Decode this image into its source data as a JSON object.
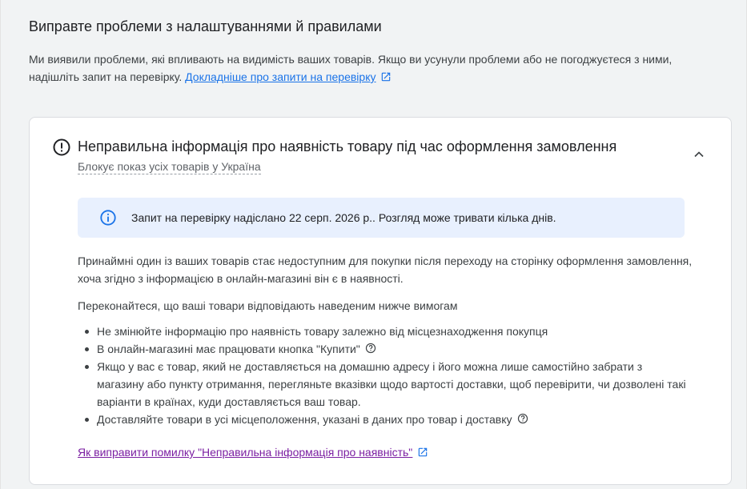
{
  "header": {
    "title": "Виправте проблеми з налаштуваннями й правилами",
    "intro_text": "Ми виявили проблеми, які впливають на видимість ваших товарів. Якщо ви усунули проблеми або не погоджуєтеся з ними, надішліть запит на перевірку.",
    "intro_link": "Докладніше про запити на перевірку"
  },
  "issue": {
    "title": "Неправильна інформація про наявність товару під час оформлення замовлення",
    "subtitle": "Блокує показ усіх товарів у Україна",
    "info_message": "Запит на перевірку надіслано 22 серп. 2026 р.. Розгляд може тривати кілька днів.",
    "description": "Принаймні один із ваших товарів стає недоступним для покупки після переходу на сторінку оформлення замовлення, хоча згідно з інформацією в онлайн-магазині він є в наявності.",
    "requirements_intro": "Переконайтеся, що ваші товари відповідають наведеним нижче вимогам",
    "requirements": [
      "Не змінюйте інформацію про наявність товару залежно від місцезнаходження покупця",
      "В онлайн-магазині має працювати кнопка \"Купити\"",
      "Якщо у вас є товар, який не доставляється на домашню адресу і його можна лише самостійно забрати з магазину або пункту отримання, перегляньте вказівки щодо вартості доставки, щоб перевірити, чи дозволені такі варіанти в країнах, куди доставляється ваш товар.",
      "Доставляйте товари в усі місцеположення, указані в даних про товар і доставку"
    ],
    "fix_link": "Як виправити помилку \"Неправильна інформація про наявність\""
  },
  "colors": {
    "link": "#1a73e8",
    "visited_link": "#7b1fa2",
    "info_bg": "#e8f0fe",
    "info_icon": "#1a73e8"
  },
  "icons": [
    "external-link-icon",
    "error-outline-icon",
    "chevron-up-icon",
    "info-icon",
    "help-icon"
  ]
}
